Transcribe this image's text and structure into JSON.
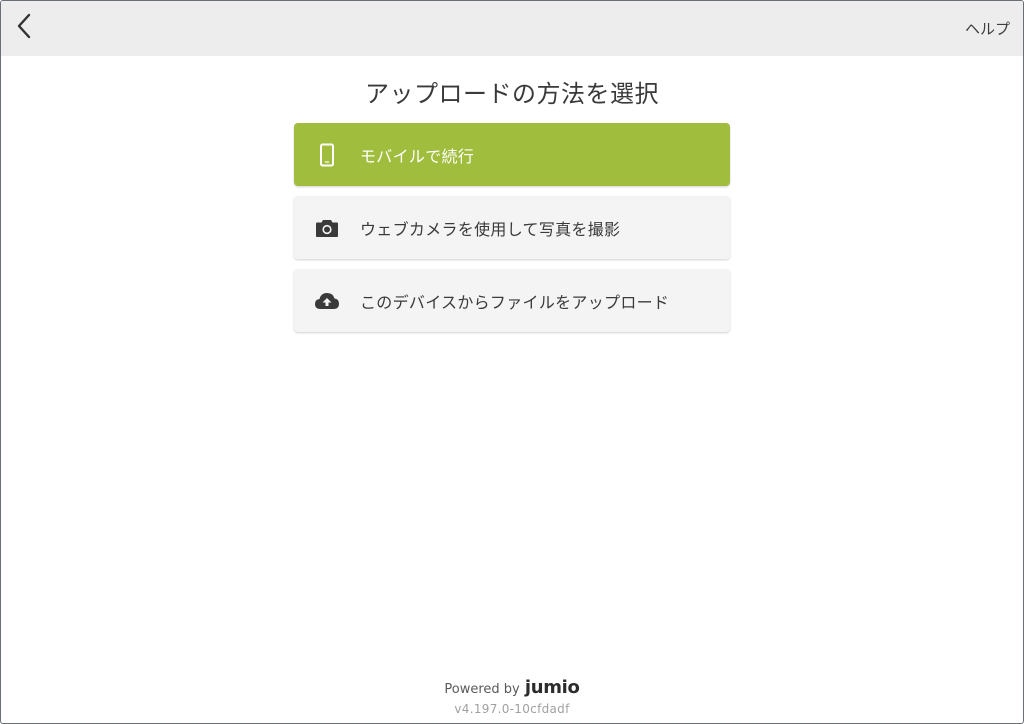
{
  "header": {
    "back_icon": "chevron-left-icon",
    "help_label": "ヘルプ"
  },
  "main": {
    "title": "アップロードの方法を選択",
    "options": [
      {
        "label": "モバイルで続行",
        "icon": "smartphone-icon",
        "selected": true,
        "background": "#a0bd3e"
      },
      {
        "label": "ウェブカメラを使用して写真を撮影",
        "icon": "camera-icon",
        "selected": false,
        "background": "#f4f4f4"
      },
      {
        "label": "このデバイスからファイルをアップロード",
        "icon": "cloud-upload-icon",
        "selected": false,
        "background": "#f4f4f4"
      }
    ]
  },
  "footer": {
    "powered_by": "Powered by",
    "brand": "jumio",
    "version": "v4.197.0-10cfdadf"
  },
  "colors": {
    "accent": "#a0bd3e",
    "topbar": "#ededed"
  }
}
